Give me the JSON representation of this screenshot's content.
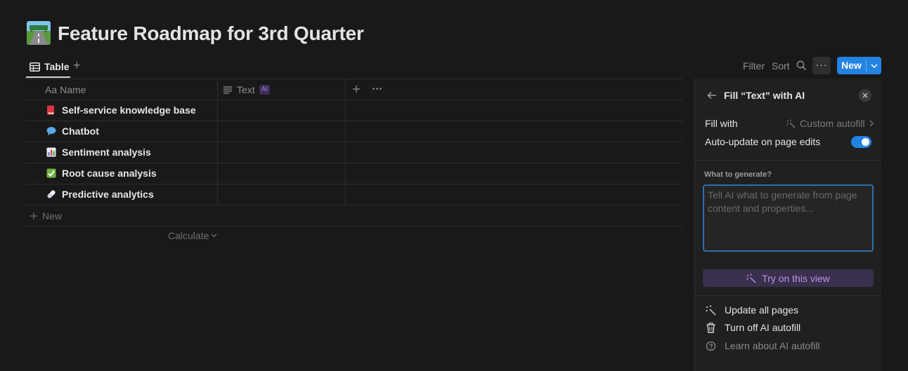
{
  "page": {
    "title": "Feature Roadmap for 3rd Quarter",
    "icon": "road-image-icon"
  },
  "views": {
    "active_tab": "Table",
    "add_view_label": "+"
  },
  "toolbar": {
    "filter": "Filter",
    "sort": "Sort",
    "more": "···",
    "new_label": "New"
  },
  "table": {
    "columns": [
      {
        "name": "Name",
        "prefix": "Aa",
        "icon": "title-icon"
      },
      {
        "name": "Text",
        "icon": "text-lines-icon",
        "badge": "AI"
      }
    ],
    "rows": [
      {
        "name": "Self-service knowledge base",
        "icon": "book-icon",
        "color": "#d9343f"
      },
      {
        "name": "Chatbot",
        "icon": "speech-bubble-icon",
        "color": "#5aa7e6"
      },
      {
        "name": "Sentiment analysis",
        "icon": "bar-chart-icon",
        "color": "#8a8fa0"
      },
      {
        "name": "Root cause analysis",
        "icon": "check-mark-icon",
        "color": "#6fb23d"
      },
      {
        "name": "Predictive analytics",
        "icon": "pill-icon",
        "color": "#cfd3da"
      }
    ],
    "new_row_label": "New",
    "calculate_label": "Calculate"
  },
  "panel": {
    "title": "Fill “Text” with AI",
    "fill_with_label": "Fill with",
    "fill_with_value": "Custom autofill",
    "auto_update_label": "Auto-update on page edits",
    "auto_update_on": true,
    "generate_label": "What to generate?",
    "generate_placeholder": "Tell AI what to generate from page content and properties...",
    "try_button": "Try on this view",
    "actions": [
      {
        "label": "Update all pages",
        "icon": "sparkle-icon"
      },
      {
        "label": "Turn off AI autofill",
        "icon": "trash-icon"
      },
      {
        "label": "Learn about AI autofill",
        "icon": "help-circle-icon"
      }
    ]
  },
  "colors": {
    "accent": "#2383e2",
    "ai_purple": "#b596e8",
    "background": "#191919",
    "panel": "#202020"
  }
}
